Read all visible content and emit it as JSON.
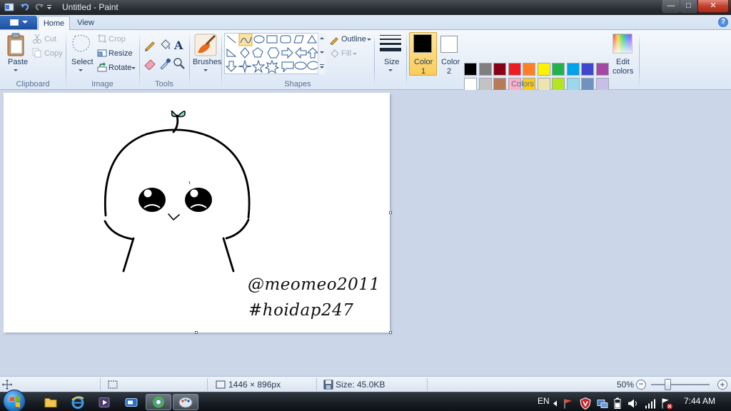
{
  "window": {
    "title": "Untitled - Paint",
    "controls": {
      "minimize": "—",
      "maximize": "□",
      "close": "✕"
    }
  },
  "tabs": [
    {
      "label": "Home",
      "active": true
    },
    {
      "label": "View",
      "active": false
    }
  ],
  "help_label": "?",
  "ribbon": {
    "clipboard": {
      "group_label": "Clipboard",
      "paste": "Paste",
      "cut": "Cut",
      "copy": "Copy"
    },
    "image": {
      "group_label": "Image",
      "select": "Select",
      "crop": "Crop",
      "resize": "Resize",
      "rotate": "Rotate"
    },
    "tools": {
      "group_label": "Tools"
    },
    "brushes": {
      "label": "Brushes"
    },
    "shapes": {
      "group_label": "Shapes",
      "outline": "Outline",
      "fill": "Fill"
    },
    "size": {
      "label": "Size"
    },
    "colors": {
      "group_label": "Colors",
      "color1_label_line1": "Color",
      "color1_label_line2": "1",
      "color2_label_line1": "Color",
      "color2_label_line2": "2",
      "edit_label_line1": "Edit",
      "edit_label_line2": "colors",
      "color1": "#000000",
      "color2": "#ffffff",
      "palette_row1": [
        "#000000",
        "#7f7f7f",
        "#880015",
        "#ed1c24",
        "#ff7f27",
        "#fff200",
        "#22b14c",
        "#00a2e8",
        "#3f48cc",
        "#a349a4"
      ],
      "palette_row2": [
        "#ffffff",
        "#c3c3c3",
        "#b97a57",
        "#ffaec9",
        "#ffc90e",
        "#efe4b0",
        "#b5e61d",
        "#99d9ea",
        "#7092be",
        "#c8bfe7"
      ]
    }
  },
  "canvas": {
    "text_line1": "@meomeo2011",
    "text_line2": "#hoidap247"
  },
  "status": {
    "dimensions": "1446 × 896px",
    "size": "Size: 45.0KB",
    "zoom": "50%"
  },
  "taskbar": {
    "language": "EN",
    "time": "7:44 AM"
  }
}
